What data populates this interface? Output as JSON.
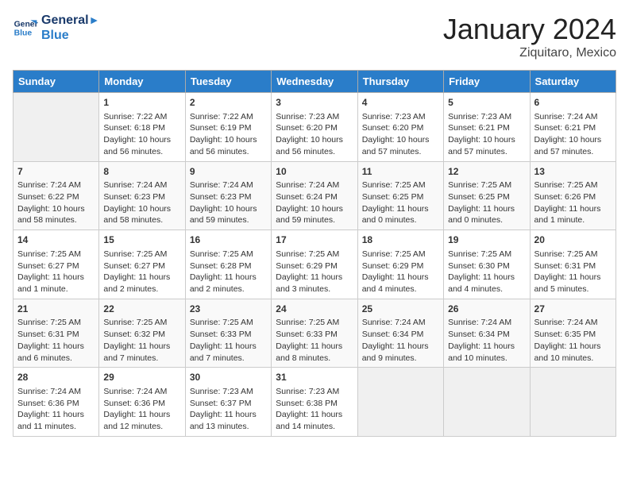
{
  "logo": {
    "line1": "General",
    "line2": "Blue"
  },
  "title": "January 2024",
  "location": "Ziquitaro, Mexico",
  "days_header": [
    "Sunday",
    "Monday",
    "Tuesday",
    "Wednesday",
    "Thursday",
    "Friday",
    "Saturday"
  ],
  "weeks": [
    [
      {
        "num": "",
        "info": ""
      },
      {
        "num": "1",
        "info": "Sunrise: 7:22 AM\nSunset: 6:18 PM\nDaylight: 10 hours\nand 56 minutes."
      },
      {
        "num": "2",
        "info": "Sunrise: 7:22 AM\nSunset: 6:19 PM\nDaylight: 10 hours\nand 56 minutes."
      },
      {
        "num": "3",
        "info": "Sunrise: 7:23 AM\nSunset: 6:20 PM\nDaylight: 10 hours\nand 56 minutes."
      },
      {
        "num": "4",
        "info": "Sunrise: 7:23 AM\nSunset: 6:20 PM\nDaylight: 10 hours\nand 57 minutes."
      },
      {
        "num": "5",
        "info": "Sunrise: 7:23 AM\nSunset: 6:21 PM\nDaylight: 10 hours\nand 57 minutes."
      },
      {
        "num": "6",
        "info": "Sunrise: 7:24 AM\nSunset: 6:21 PM\nDaylight: 10 hours\nand 57 minutes."
      }
    ],
    [
      {
        "num": "7",
        "info": "Sunrise: 7:24 AM\nSunset: 6:22 PM\nDaylight: 10 hours\nand 58 minutes."
      },
      {
        "num": "8",
        "info": "Sunrise: 7:24 AM\nSunset: 6:23 PM\nDaylight: 10 hours\nand 58 minutes."
      },
      {
        "num": "9",
        "info": "Sunrise: 7:24 AM\nSunset: 6:23 PM\nDaylight: 10 hours\nand 59 minutes."
      },
      {
        "num": "10",
        "info": "Sunrise: 7:24 AM\nSunset: 6:24 PM\nDaylight: 10 hours\nand 59 minutes."
      },
      {
        "num": "11",
        "info": "Sunrise: 7:25 AM\nSunset: 6:25 PM\nDaylight: 11 hours\nand 0 minutes."
      },
      {
        "num": "12",
        "info": "Sunrise: 7:25 AM\nSunset: 6:25 PM\nDaylight: 11 hours\nand 0 minutes."
      },
      {
        "num": "13",
        "info": "Sunrise: 7:25 AM\nSunset: 6:26 PM\nDaylight: 11 hours\nand 1 minute."
      }
    ],
    [
      {
        "num": "14",
        "info": "Sunrise: 7:25 AM\nSunset: 6:27 PM\nDaylight: 11 hours\nand 1 minute."
      },
      {
        "num": "15",
        "info": "Sunrise: 7:25 AM\nSunset: 6:27 PM\nDaylight: 11 hours\nand 2 minutes."
      },
      {
        "num": "16",
        "info": "Sunrise: 7:25 AM\nSunset: 6:28 PM\nDaylight: 11 hours\nand 2 minutes."
      },
      {
        "num": "17",
        "info": "Sunrise: 7:25 AM\nSunset: 6:29 PM\nDaylight: 11 hours\nand 3 minutes."
      },
      {
        "num": "18",
        "info": "Sunrise: 7:25 AM\nSunset: 6:29 PM\nDaylight: 11 hours\nand 4 minutes."
      },
      {
        "num": "19",
        "info": "Sunrise: 7:25 AM\nSunset: 6:30 PM\nDaylight: 11 hours\nand 4 minutes."
      },
      {
        "num": "20",
        "info": "Sunrise: 7:25 AM\nSunset: 6:31 PM\nDaylight: 11 hours\nand 5 minutes."
      }
    ],
    [
      {
        "num": "21",
        "info": "Sunrise: 7:25 AM\nSunset: 6:31 PM\nDaylight: 11 hours\nand 6 minutes."
      },
      {
        "num": "22",
        "info": "Sunrise: 7:25 AM\nSunset: 6:32 PM\nDaylight: 11 hours\nand 7 minutes."
      },
      {
        "num": "23",
        "info": "Sunrise: 7:25 AM\nSunset: 6:33 PM\nDaylight: 11 hours\nand 7 minutes."
      },
      {
        "num": "24",
        "info": "Sunrise: 7:25 AM\nSunset: 6:33 PM\nDaylight: 11 hours\nand 8 minutes."
      },
      {
        "num": "25",
        "info": "Sunrise: 7:24 AM\nSunset: 6:34 PM\nDaylight: 11 hours\nand 9 minutes."
      },
      {
        "num": "26",
        "info": "Sunrise: 7:24 AM\nSunset: 6:34 PM\nDaylight: 11 hours\nand 10 minutes."
      },
      {
        "num": "27",
        "info": "Sunrise: 7:24 AM\nSunset: 6:35 PM\nDaylight: 11 hours\nand 10 minutes."
      }
    ],
    [
      {
        "num": "28",
        "info": "Sunrise: 7:24 AM\nSunset: 6:36 PM\nDaylight: 11 hours\nand 11 minutes."
      },
      {
        "num": "29",
        "info": "Sunrise: 7:24 AM\nSunset: 6:36 PM\nDaylight: 11 hours\nand 12 minutes."
      },
      {
        "num": "30",
        "info": "Sunrise: 7:23 AM\nSunset: 6:37 PM\nDaylight: 11 hours\nand 13 minutes."
      },
      {
        "num": "31",
        "info": "Sunrise: 7:23 AM\nSunset: 6:38 PM\nDaylight: 11 hours\nand 14 minutes."
      },
      {
        "num": "",
        "info": ""
      },
      {
        "num": "",
        "info": ""
      },
      {
        "num": "",
        "info": ""
      }
    ]
  ]
}
